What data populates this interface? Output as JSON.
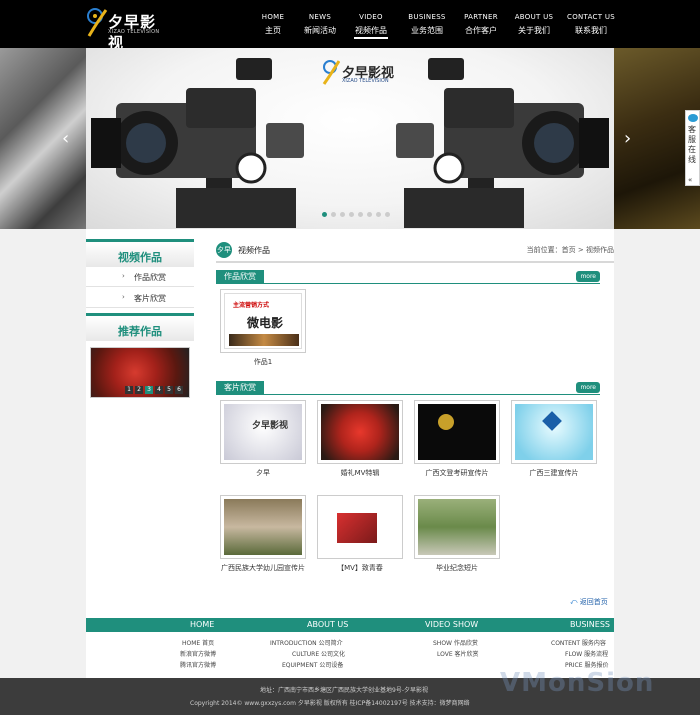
{
  "brand": {
    "name": "夕早影视",
    "subtitle": "XIZAO TELEVISION"
  },
  "nav": [
    {
      "en": "HOME",
      "cn": "主页",
      "active": false
    },
    {
      "en": "NEWS",
      "cn": "新闻活动",
      "active": false
    },
    {
      "en": "VIDEO",
      "cn": "视频作品",
      "active": true
    },
    {
      "en": "BUSINESS",
      "cn": "业务范围",
      "active": false
    },
    {
      "en": "PARTNER",
      "cn": "合作客户",
      "active": false
    },
    {
      "en": "ABOUT US",
      "cn": "关于我们",
      "active": false
    },
    {
      "en": "CONTACT US",
      "cn": "联系我们",
      "active": false
    }
  ],
  "banner": {
    "prev": "‹",
    "next": "›",
    "slide_count": 8,
    "active_slide": 1
  },
  "service": {
    "label": "客服在线",
    "collapse": "«"
  },
  "sidebar": {
    "video_title": "视频作品",
    "links": [
      "作品欣赏",
      "客片欣赏"
    ],
    "recommend_title": "推荐作品",
    "pager": [
      "1",
      "2",
      "3",
      "4",
      "5",
      "6"
    ],
    "pager_active": 3
  },
  "crumb": {
    "icon": "夕早",
    "title": "视频作品",
    "location": "当前位置：首页 > 视频作品"
  },
  "sections": [
    {
      "tab": "作品欣赏",
      "more": "more"
    },
    {
      "tab": "客片欣赏",
      "more": "more"
    }
  ],
  "works": [
    {
      "caption": "作品1",
      "poster_line1": "主流营销方式",
      "poster_line2": "微电影"
    }
  ],
  "client_videos": [
    {
      "caption": "夕早"
    },
    {
      "caption": "婚礼MV特辑"
    },
    {
      "caption": "广西文登考研宣传片"
    },
    {
      "caption": "广西三建宣传片"
    },
    {
      "caption": "广西民族大学幼儿园宣传片"
    },
    {
      "caption": "【MV】致青春"
    },
    {
      "caption": "毕业纪念短片"
    }
  ],
  "back_top": "返回首页",
  "footer_nav": {
    "columns": [
      {
        "title": "HOME",
        "links": [
          "HOME 首页",
          "新浪官方微博",
          "腾讯官方微博"
        ]
      },
      {
        "title": "ABOUT US",
        "links": [
          "INTRODUCTION 公司简介",
          "CULTURE 公司文化",
          "EQUIPMENT 公司设备"
        ]
      },
      {
        "title": "VIDEO SHOW",
        "links": [
          "SHOW 作品欣赏",
          "LOVE 客片欣赏"
        ]
      },
      {
        "title": "BUSINESS",
        "links": [
          "CONTENT 服务内容",
          "FLOW 服务流程",
          "PRICE 服务报价"
        ]
      }
    ]
  },
  "footer": {
    "address": "地址：广西南宁市西乡塘区广西民族大学创业基地9号-夕早影视",
    "copyright": "Copyright 2014© www.gxxzys.com 夕早影视 版权所有 桂ICP备14002197号 技术支持：微梦商网络"
  },
  "watermark": "VMonSion",
  "colors": {
    "accent": "#1f8f7d",
    "header_bg": "#000000",
    "footer_bg": "#3c3c3c"
  }
}
